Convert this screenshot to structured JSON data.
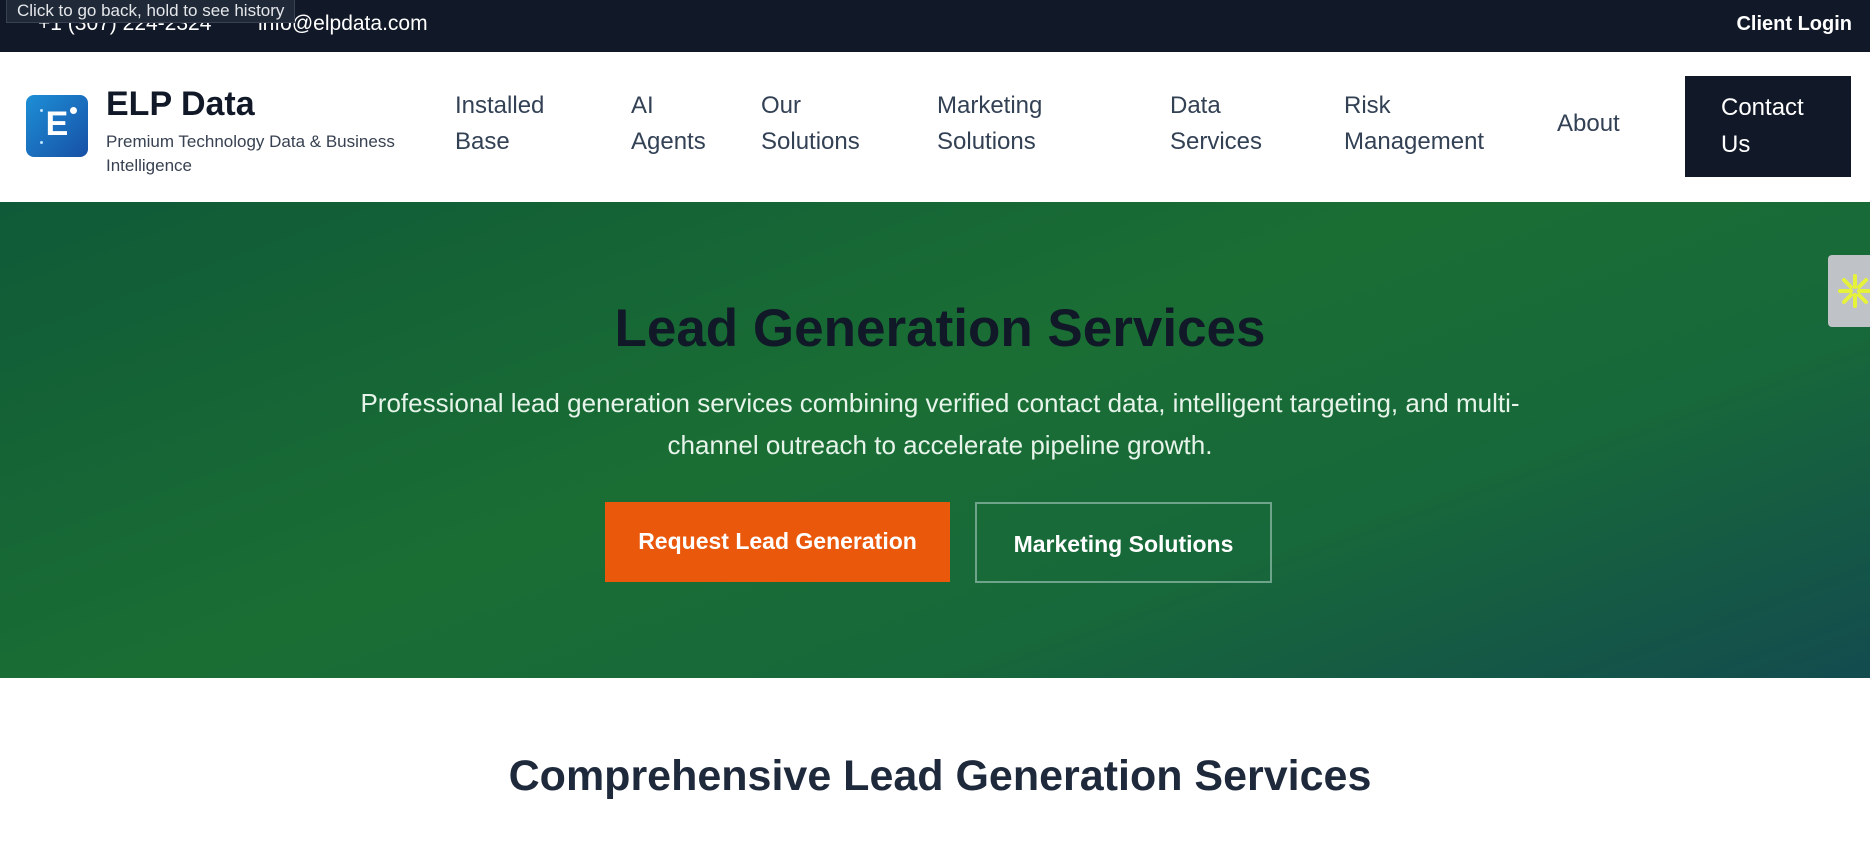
{
  "topbar": {
    "phone": "+1 (307) 224-2324",
    "email": "info@elpdata.com",
    "client_login": "Client Login"
  },
  "tooltip": "Click to go back, hold to see history",
  "brand": {
    "logo_letter": "E",
    "name": "ELP Data",
    "tagline": "Premium Technology Data & Business Intelligence"
  },
  "nav": {
    "items": [
      {
        "line1": "Installed",
        "line2": "Base"
      },
      {
        "line1": "AI",
        "line2": "Agents"
      },
      {
        "line1": "Our",
        "line2": "Solutions"
      },
      {
        "line1": "Marketing",
        "line2": "Solutions"
      },
      {
        "line1": "Data",
        "line2": "Services"
      },
      {
        "line1": "Risk",
        "line2": "Management"
      },
      {
        "line1": "About",
        "line2": ""
      }
    ],
    "contact": {
      "line1": "Contact",
      "line2": "Us"
    }
  },
  "hero": {
    "title": "Lead Generation Services",
    "subtitle": "Professional lead generation services combining verified contact data, intelligent targeting, and multi-channel outreach to accelerate pipeline growth.",
    "primary_button": "Request Lead Generation",
    "secondary_button": "Marketing Solutions"
  },
  "side_widget": {
    "icon": "asterisk-icon",
    "color": "#e6f23a"
  },
  "section": {
    "title": "Comprehensive Lead Generation Services"
  },
  "colors": {
    "topbar": "#111827",
    "accent_orange": "#ea580c",
    "hero_green": "#1a6e34",
    "logo_blue": "#1d6fc0"
  }
}
